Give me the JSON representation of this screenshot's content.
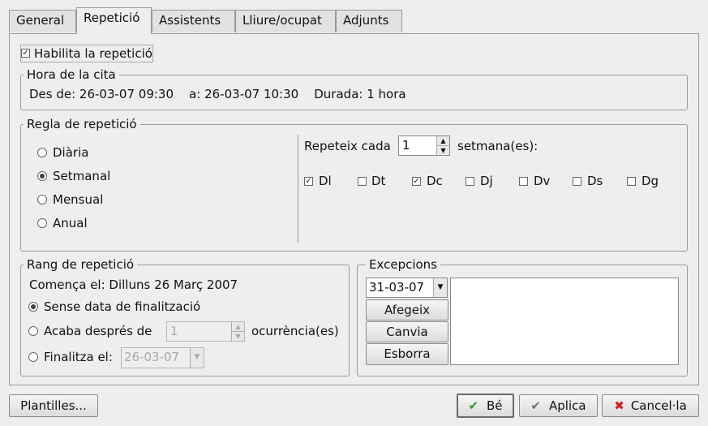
{
  "tabs": [
    {
      "label": "General"
    },
    {
      "label": "Repetició"
    },
    {
      "label": "Assistents"
    },
    {
      "label": "Lliure/ocupat"
    },
    {
      "label": "Adjunts"
    }
  ],
  "enable_recurrence": {
    "label": "Habilita la repetició",
    "checked": true
  },
  "appointment_time": {
    "title": "Hora de la cita",
    "summary": "Des de: 26-03-07 09:30    a: 26-03-07 10:30    Durada: 1 hora"
  },
  "rule": {
    "title": "Regla de repetició",
    "options": [
      {
        "label": "Diària",
        "selected": false
      },
      {
        "label": "Setmanal",
        "selected": true
      },
      {
        "label": "Mensual",
        "selected": false
      },
      {
        "label": "Anual",
        "selected": false
      }
    ],
    "repeat_every_label": "Repeteix cada",
    "repeat_every_value": "1",
    "unit_label": "setmana(es):",
    "days": [
      {
        "label": "Dl",
        "checked": true
      },
      {
        "label": "Dt",
        "checked": false
      },
      {
        "label": "Dc",
        "checked": true
      },
      {
        "label": "Dj",
        "checked": false
      },
      {
        "label": "Dv",
        "checked": false
      },
      {
        "label": "Ds",
        "checked": false
      },
      {
        "label": "Dg",
        "checked": false
      }
    ]
  },
  "range": {
    "title": "Rang de repetició",
    "start_text": "Comença el: Dilluns 26 Març 2007",
    "no_end_label": "Sense data de finalització",
    "end_after_label": "Acaba després de",
    "end_after_value": "1",
    "occurrences_label": "ocurrència(es)",
    "end_on_label": "Finalitza el:",
    "end_on_value": "26-03-07",
    "selected": "no_end"
  },
  "exceptions": {
    "title": "Excepcions",
    "date_value": "31-03-07",
    "add_label": "Afegeix",
    "change_label": "Canvia",
    "delete_label": "Esborra"
  },
  "footer": {
    "templates_label": "Plantilles...",
    "ok_label": "Bé",
    "apply_label": "Aplica",
    "cancel_label": "Cancel·la"
  },
  "colors": {
    "ok_check": "#2a9a2a",
    "apply_check": "#707070",
    "cancel_x": "#d02020"
  }
}
